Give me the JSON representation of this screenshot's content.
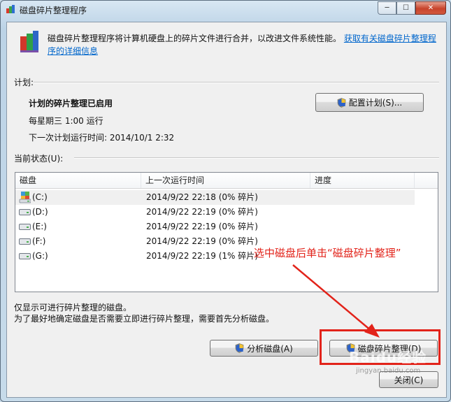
{
  "window": {
    "title": "磁盘碎片整理程序",
    "buttons": {
      "minimize": "─",
      "maximize": "☐",
      "close": "✕"
    }
  },
  "intro": {
    "text": "磁盘碎片整理程序将计算机硬盘上的碎片文件进行合并，以改进文件系统性能。",
    "link": "获取有关磁盘碎片整理程序的详细信息"
  },
  "schedule": {
    "section_label": "计划:",
    "status": "计划的碎片整理已启用",
    "frequency": "每星期三  1:00 运行",
    "next_run": "下一次计划运行时间: 2014/10/1 2:32",
    "configure_button": "配置计划(S)..."
  },
  "current_status": {
    "section_label": "当前状态(U):",
    "columns": [
      "磁盘",
      "上一次运行时间",
      "进度"
    ],
    "rows": [
      {
        "disk": "(C:)",
        "last_run": "2014/9/22 22:18 (0% 碎片)",
        "progress": "",
        "icon": "system-drive-icon"
      },
      {
        "disk": "(D:)",
        "last_run": "2014/9/22 22:19 (0% 碎片)",
        "progress": "",
        "icon": "hard-drive-icon"
      },
      {
        "disk": "(E:)",
        "last_run": "2014/9/22 22:19 (0% 碎片)",
        "progress": "",
        "icon": "hard-drive-icon"
      },
      {
        "disk": "(F:)",
        "last_run": "2014/9/22 22:19 (0% 碎片)",
        "progress": "",
        "icon": "hard-drive-icon"
      },
      {
        "disk": "(G:)",
        "last_run": "2014/9/22 22:19 (1% 碎片)",
        "progress": "",
        "icon": "hard-drive-icon"
      }
    ]
  },
  "notes": {
    "line1": "仅显示可进行碎片整理的磁盘。",
    "line2": "为了最好地确定磁盘是否需要立即进行碎片整理，需要首先分析磁盘。"
  },
  "actions": {
    "analyze": "分析磁盘(A)",
    "defrag": "磁盘碎片整理(D)",
    "close": "关闭(C)"
  },
  "annotation": {
    "text": "选中磁盘后单击“磁盘碎片整理”",
    "color": "#e2231a"
  },
  "watermark": {
    "text": "Baidu经验",
    "sub": "jingyan.baidu.com"
  }
}
